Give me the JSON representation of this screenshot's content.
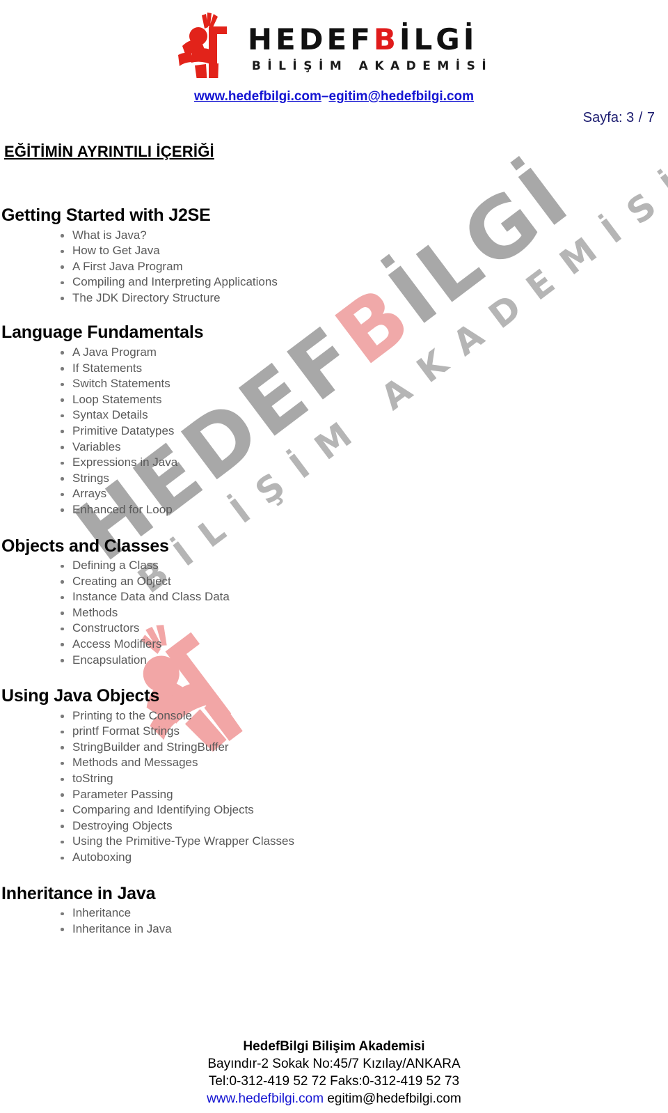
{
  "header": {
    "logo": {
      "mark": "hedefbilgi-figure-icon",
      "word_part1": "HEDEF",
      "word_red": "B",
      "word_part2": "İLGİ",
      "subtitle": "BİLİŞİM AKADEMİSİ"
    },
    "website_link": "www.hedefbilgi.com",
    "separator": "–",
    "email_link": "egitim@hedefbilgi.com",
    "page_label": "Sayfa:",
    "page_current": "3",
    "page_separator": "/",
    "page_total": "7"
  },
  "watermark": {
    "line1_part1": "HEDEF",
    "line1_b": "B",
    "line1_part2": "İLGİ",
    "line2": "BİLİŞİM AKADEMİSİ"
  },
  "document": {
    "title": "EĞİTİMİN AYRINTILI İÇERİĞİ",
    "sections": [
      {
        "heading": "Getting Started with J2SE",
        "items": [
          "What is Java?",
          "How to Get Java",
          "A First Java Program",
          "Compiling and Interpreting Applications",
          "The JDK Directory Structure"
        ]
      },
      {
        "heading": "Language Fundamentals",
        "items": [
          "A Java Program",
          "If Statements",
          "Switch Statements",
          "Loop Statements",
          "Syntax Details",
          "Primitive Datatypes",
          "Variables",
          "Expressions in Java",
          "Strings",
          "Arrays",
          "Enhanced for Loop"
        ]
      },
      {
        "heading": "Objects and Classes",
        "items": [
          "Defining a Class",
          "Creating an Object",
          "Instance Data and Class Data",
          "Methods",
          "Constructors",
          "Access Modifiers",
          "Encapsulation"
        ]
      },
      {
        "heading": "Using Java Objects",
        "items": [
          "Printing to the Console",
          "printf Format Strings",
          "StringBuilder and StringBuffer",
          "Methods and Messages",
          "toString",
          "Parameter Passing",
          "Comparing and Identifying Objects",
          "Destroying Objects",
          "Using the Primitive-Type Wrapper Classes",
          "Autoboxing"
        ]
      },
      {
        "heading": "Inheritance in Java",
        "items": [
          "Inheritance",
          "Inheritance in Java"
        ]
      }
    ]
  },
  "footer": {
    "company": "HedefBilgi Bilişim Akademisi",
    "address": "Bayındır-2 Sokak No:45/7 Kızılay/ANKARA",
    "phone": "Tel:0-312-419 52 72 Faks:0-312-419 52 73",
    "website": "www.hedefbilgi.com",
    "email": "egitim@hedefbilgi.com"
  },
  "colors": {
    "brand_red": "#e01b1b",
    "link_blue": "#1414d2",
    "page_navy": "#1a1a6e",
    "bullet_gray": "#5a5a5a",
    "watermark_gray": "#a8a8a8",
    "watermark_pink": "#f0a9a9"
  }
}
